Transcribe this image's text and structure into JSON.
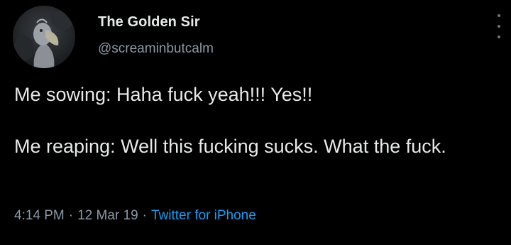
{
  "author": {
    "display_name": "The Golden Sir",
    "handle": "@screaminbutcalm",
    "avatar_icon": "shoebill-bird-avatar"
  },
  "tweet": {
    "lines": [
      "Me sowing: Haha fuck yeah!!! Yes!!",
      "Me reaping: Well this fucking sucks. What the fuck."
    ],
    "time": "4:14 PM",
    "date": "12 Mar 19",
    "separator": "·",
    "source": "Twitter for iPhone"
  },
  "icons": {
    "more": "more-vertical-icon"
  },
  "colors": {
    "background": "#000000",
    "text": "#e7e9ea",
    "secondary_text": "#8b98a5",
    "link": "#1d9bf0"
  }
}
